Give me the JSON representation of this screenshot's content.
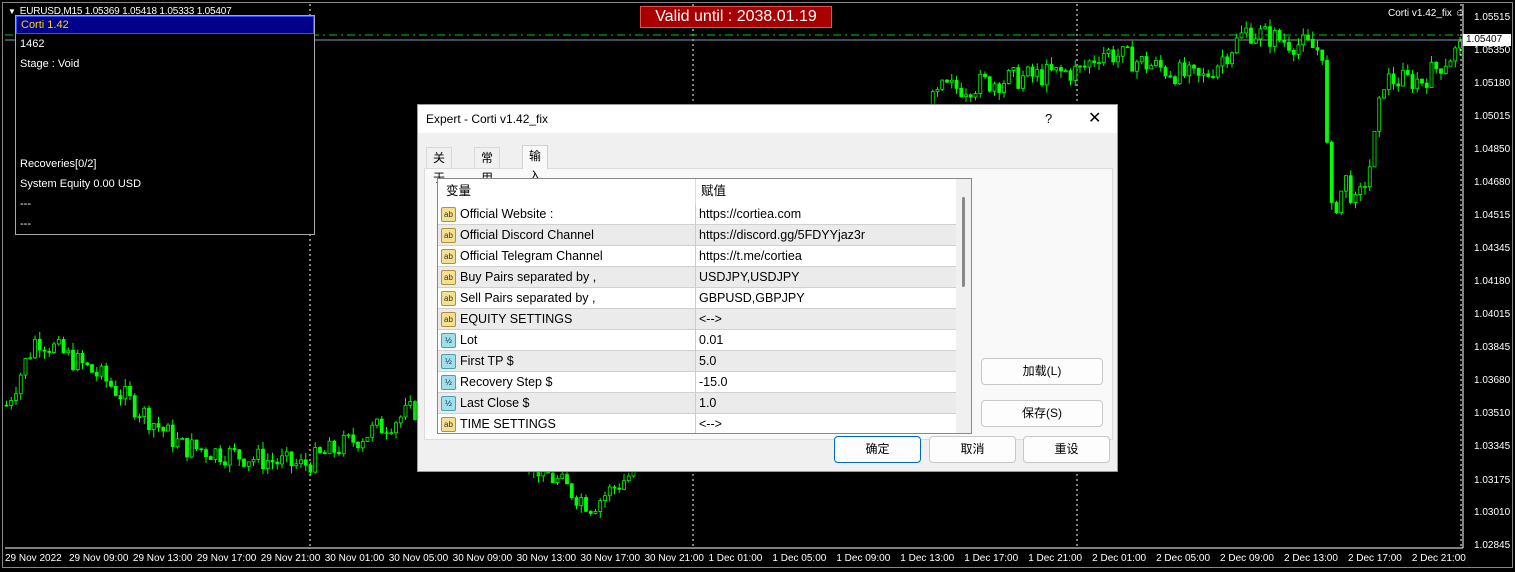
{
  "chart": {
    "symbol_line": "EURUSD,M15  1.05369 1.05418 1.05333 1.05407",
    "valid_until": "Valid until : 2038.01.19",
    "ea_label": "Corti v1.42_fix",
    "smiley_icon": "smiley-icon",
    "current_price": "1.05407",
    "bull_color": "#00ff00",
    "price_axis": [
      "1.05515",
      "1.05350",
      "1.05180",
      "1.05015",
      "1.04850",
      "1.04680",
      "1.04515",
      "1.04345",
      "1.04180",
      "1.04015",
      "1.03845",
      "1.03680",
      "1.03510",
      "1.03345",
      "1.03175",
      "1.03010",
      "1.02845"
    ],
    "time_axis": [
      "29 Nov 2022",
      "29 Nov 09:00",
      "29 Nov 13:00",
      "29 Nov 17:00",
      "29 Nov 21:00",
      "30 Nov 01:00",
      "30 Nov 05:00",
      "30 Nov 09:00",
      "30 Nov 13:00",
      "30 Nov 17:00",
      "30 Nov 21:00",
      "1 Dec 01:00",
      "1 Dec 05:00",
      "1 Dec 09:00",
      "1 Dec 13:00",
      "1 Dec 17:00",
      "1 Dec 21:00",
      "2 Dec 01:00",
      "2 Dec 05:00",
      "2 Dec 09:00",
      "2 Dec 13:00",
      "2 Dec 17:00",
      "2 Dec 21:00"
    ]
  },
  "panel": {
    "title": "Corti 1.42",
    "lines": [
      "1462",
      "Stage : Void",
      "Recoveries[0/2]",
      "System Equity 0.00 USD",
      "---",
      "---"
    ]
  },
  "dialog": {
    "title": "Expert - Corti v1.42_fix",
    "help": "?",
    "close": "✕",
    "tabs": [
      "关于",
      "常用",
      "输入参数"
    ],
    "active_tab": "输入参数",
    "columns": [
      "变量",
      "赋值"
    ],
    "rows": [
      {
        "type": "ab",
        "name": "Official Website :",
        "value": "https://cortiea.com"
      },
      {
        "type": "ab",
        "name": "Official Discord Channel",
        "value": "https://discord.gg/5FDYYjaz3r"
      },
      {
        "type": "ab",
        "name": "Official Telegram Channel",
        "value": "https://t.me/cortiea"
      },
      {
        "type": "ab",
        "name": "Buy Pairs separated by ,",
        "value": "USDJPY,USDJPY"
      },
      {
        "type": "ab",
        "name": "Sell Pairs separated by ,",
        "value": "GBPUSD,GBPJPY"
      },
      {
        "type": "ab",
        "name": "EQUITY SETTINGS",
        "value": "<-->"
      },
      {
        "type": "num",
        "name": "Lot",
        "value": "0.01"
      },
      {
        "type": "num",
        "name": "First TP $",
        "value": "5.0"
      },
      {
        "type": "num",
        "name": "Recovery Step $",
        "value": "-15.0"
      },
      {
        "type": "num",
        "name": "Last Close $",
        "value": "1.0"
      },
      {
        "type": "ab",
        "name": "TIME SETTINGS",
        "value": "<-->"
      }
    ],
    "icon_labels": {
      "ab": "ab",
      "num": "½"
    },
    "buttons": {
      "load": "加载(L)",
      "save": "保存(S)",
      "ok": "确定",
      "cancel": "取消",
      "reset": "重设"
    }
  }
}
